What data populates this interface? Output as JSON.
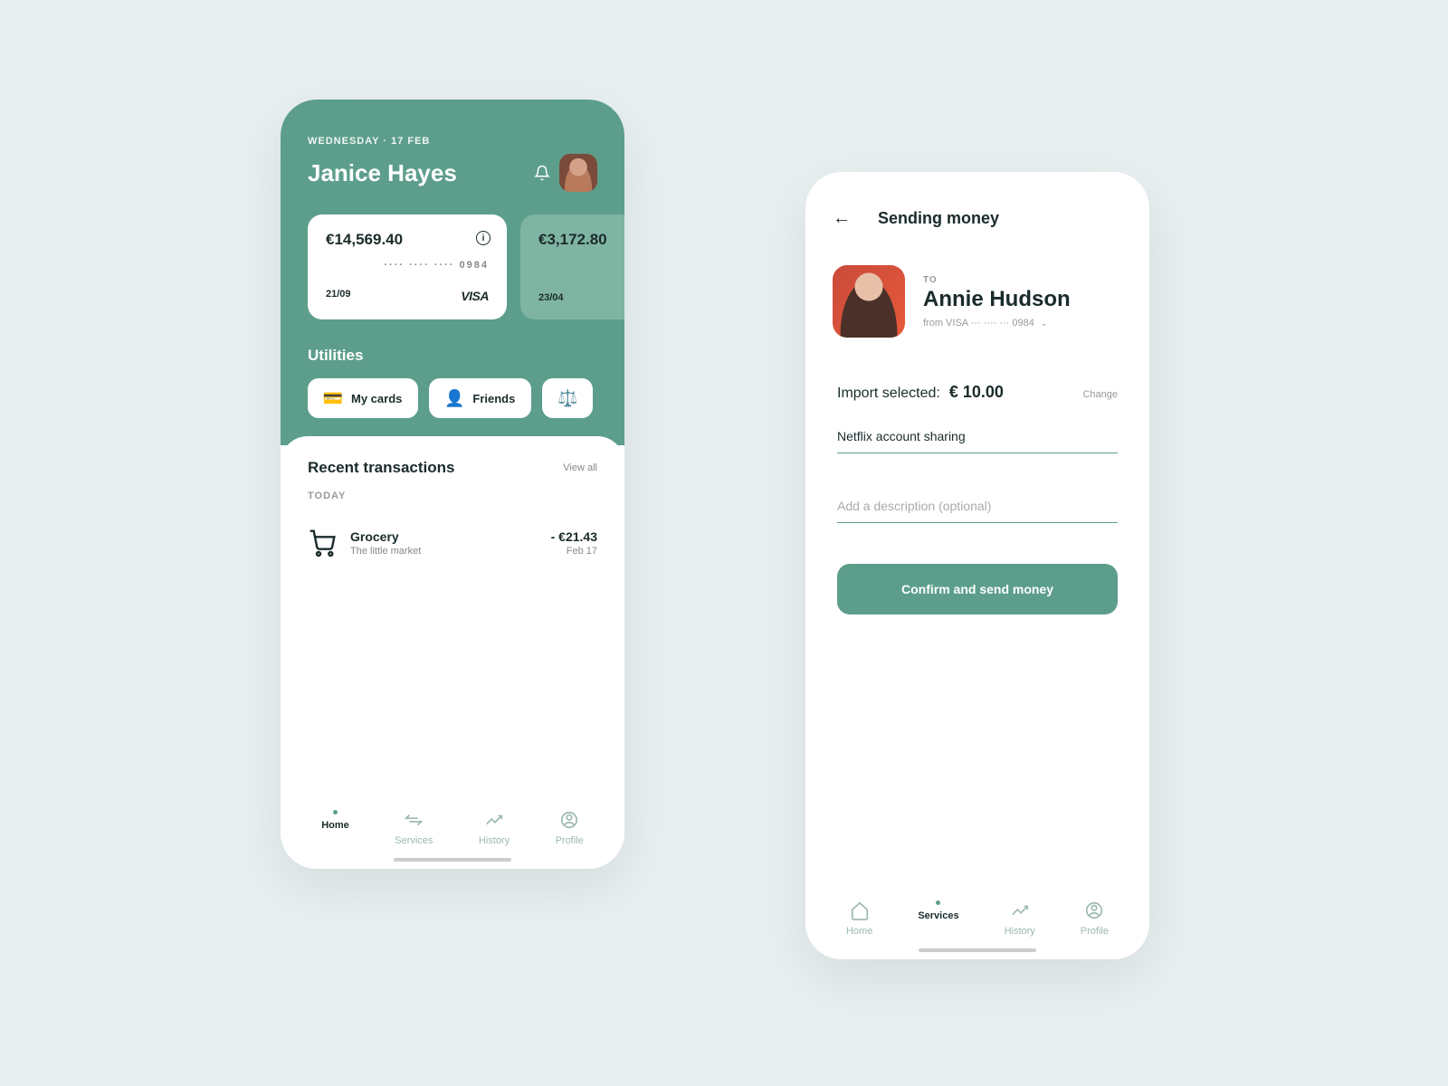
{
  "left": {
    "date": "WEDNESDAY · 17 FEB",
    "userName": "Janice Hayes",
    "cards": [
      {
        "balance": "€14,569.40",
        "dots": "···· ···· ···· 0984",
        "exp": "21/09",
        "brand": "VISA"
      },
      {
        "balance": "€3,172.80",
        "exp": "23/04"
      }
    ],
    "utilitiesTitle": "Utilities",
    "utilities": [
      {
        "label": "My cards"
      },
      {
        "label": "Friends"
      }
    ],
    "recentTitle": "Recent transactions",
    "viewAll": "View all",
    "todayLabel": "TODAY",
    "transactions": [
      {
        "title": "Grocery",
        "subtitle": "The little market",
        "amount": "- €21.43",
        "date": "Feb 17"
      }
    ],
    "nav": {
      "home": "Home",
      "services": "Services",
      "history": "History",
      "profile": "Profile"
    }
  },
  "right": {
    "title": "Sending money",
    "toLabel": "TO",
    "recipient": "Annie Hudson",
    "fromCard": "from VISA ··· ···· ··· 0984",
    "importLabel": "Import selected:",
    "importAmount": "€ 10.00",
    "changeLabel": "Change",
    "noteValue": "Netflix account sharing",
    "descPlaceholder": "Add a description (optional)",
    "confirmLabel": "Confirm and send money",
    "nav": {
      "home": "Home",
      "services": "Services",
      "history": "History",
      "profile": "Profile"
    }
  }
}
